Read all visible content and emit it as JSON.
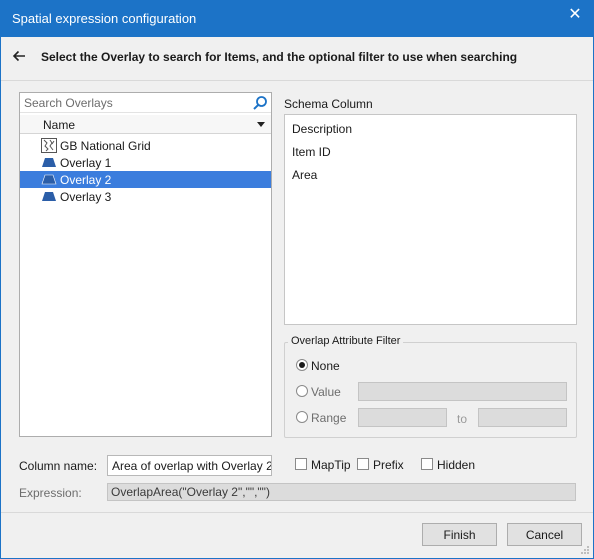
{
  "window": {
    "title": "Spatial expression configuration",
    "close_glyph": "✕"
  },
  "header": {
    "back_icon": "arrow-left-icon",
    "text": "Select the Overlay to search for Items, and the optional filter to use when searching"
  },
  "overlays": {
    "search_placeholder": "Search Overlays",
    "search_value": "",
    "column_header": "Name",
    "items": [
      {
        "label": "GB National Grid",
        "icon": "map-grid-icon",
        "selected": false
      },
      {
        "label": "Overlay 1",
        "icon": "overlay-icon",
        "selected": false
      },
      {
        "label": "Overlay 2",
        "icon": "overlay-icon",
        "selected": true
      },
      {
        "label": "Overlay 3",
        "icon": "overlay-icon",
        "selected": false
      }
    ]
  },
  "schema": {
    "label": "Schema Column",
    "items": [
      "Description",
      "Item ID",
      "Area"
    ]
  },
  "filter": {
    "legend": "Overlap Attribute Filter",
    "options": [
      {
        "label": "None",
        "checked": true
      },
      {
        "label": "Value",
        "checked": false
      },
      {
        "label": "Range",
        "checked": false
      }
    ],
    "range_to": "to"
  },
  "column": {
    "label": "Column name:",
    "value": "Area of overlap with Overlay 2"
  },
  "checks": [
    {
      "label": "MapTip",
      "checked": false
    },
    {
      "label": "Prefix",
      "checked": false
    },
    {
      "label": "Hidden",
      "checked": false
    }
  ],
  "expression": {
    "label": "Expression:",
    "value": "OverlapArea(\"Overlay 2\",\"\",\"\")"
  },
  "buttons": {
    "finish": "Finish",
    "cancel": "Cancel"
  },
  "colors": {
    "titlebar": "#1c73c7",
    "selection": "#3b7ddd",
    "overlay_icon": "#2b5ea8"
  }
}
